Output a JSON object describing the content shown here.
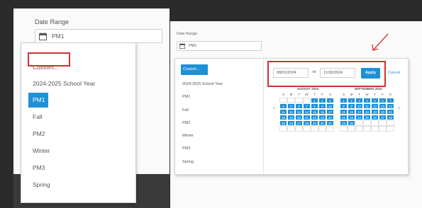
{
  "left": {
    "title": "Date Range",
    "input_value": "PM1",
    "dropdown_items": [
      "Custom...",
      "2024-2025 School Year",
      "PM1",
      "Fall",
      "PM2",
      "Winter",
      "PM3",
      "Spring"
    ],
    "selected_item": "PM1"
  },
  "right": {
    "title": "Date Range",
    "input_value": "PM1",
    "list_items": [
      "Custom...",
      "2024-2025 School Year",
      "PM1",
      "Fall",
      "PM2",
      "Winter",
      "PM3",
      "Spring"
    ],
    "start_date": "08/01/2024",
    "to_label": "to",
    "end_date": "11/30/2024",
    "apply_label": "Apply",
    "cancel_label": "Cancel",
    "month1": {
      "title": "AUGUST 2024",
      "dow": [
        "S",
        "M",
        "T",
        "W",
        "T",
        "F",
        "S"
      ],
      "days": [
        "",
        "",
        "",
        "",
        "1",
        "2",
        "3",
        "4",
        "5",
        "6",
        "7",
        "8",
        "9",
        "10",
        "11",
        "12",
        "13",
        "14",
        "15",
        "16",
        "17",
        "18",
        "19",
        "20",
        "21",
        "22",
        "23",
        "24",
        "25",
        "26",
        "27",
        "28",
        "29",
        "30",
        "31",
        "",
        "",
        "",
        "",
        "",
        "",
        ""
      ]
    },
    "month2": {
      "title": "SEPTEMBER 2024",
      "dow": [
        "S",
        "M",
        "T",
        "W",
        "T",
        "F",
        "S"
      ],
      "days": [
        "1",
        "2",
        "3",
        "4",
        "5",
        "6",
        "7",
        "8",
        "9",
        "10",
        "11",
        "12",
        "13",
        "14",
        "15",
        "16",
        "17",
        "18",
        "19",
        "20",
        "21",
        "22",
        "23",
        "24",
        "25",
        "26",
        "27",
        "28",
        "29",
        "30",
        "",
        "",
        "",
        "",
        "",
        "",
        "",
        "",
        "",
        "",
        "",
        ""
      ]
    }
  },
  "colors": {
    "accent": "#1e90d6",
    "highlight": "#d3302f"
  }
}
